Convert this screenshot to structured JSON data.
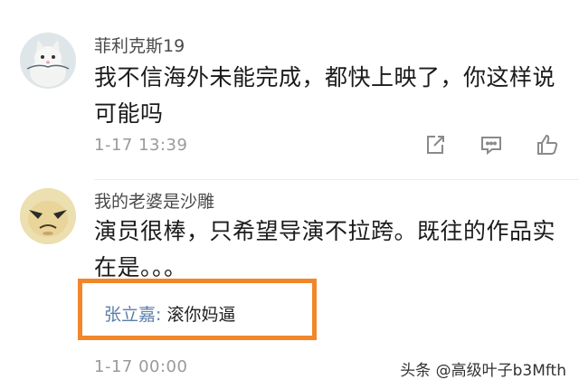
{
  "comments": [
    {
      "username": "菲利克斯19",
      "text": "我不信海外未能完成，都快上映了，你这样说可能吗",
      "timestamp": "1-17 13:39",
      "actions": [
        "share-icon",
        "comment-icon",
        "like-icon"
      ]
    },
    {
      "username": "我的老婆是沙雕",
      "text": "演员很棒，只希望导演不拉跨。既往的作品实在是。。。",
      "timestamp": "1-17 00:00",
      "reply": {
        "name": "张立嘉",
        "colon": ":",
        "text": "滚你妈逼"
      }
    }
  ],
  "watermark": "头条 @高级叶子b3Mfth",
  "colors": {
    "highlight": "#f2862a",
    "reply_name": "#5b7ea8",
    "timestamp": "#9a9a9a"
  }
}
